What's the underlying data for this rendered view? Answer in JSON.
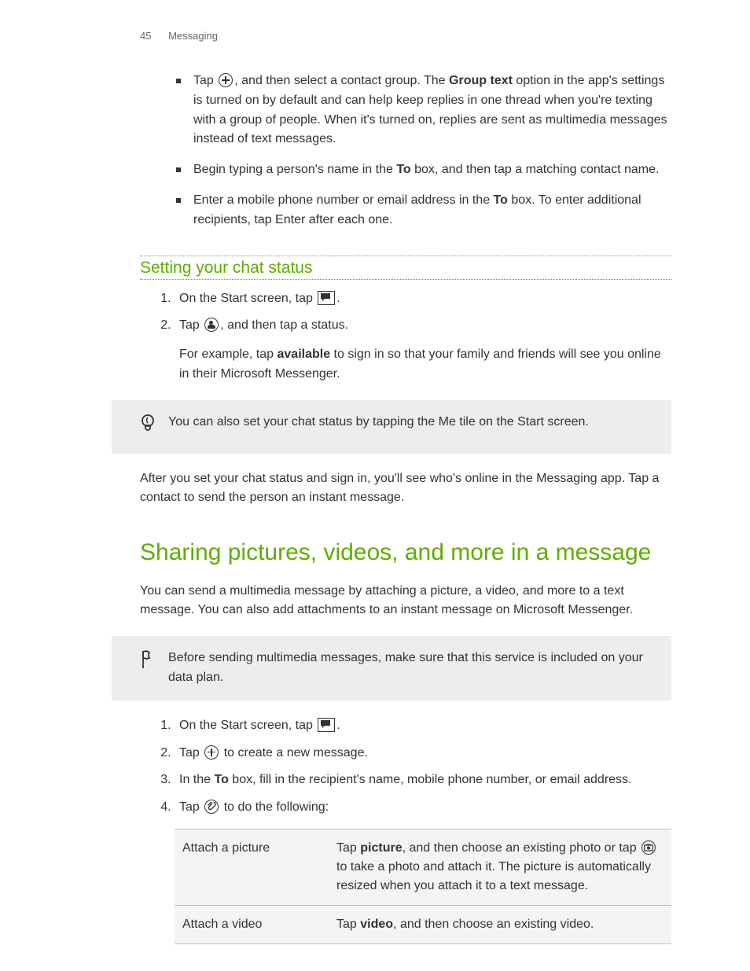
{
  "header": {
    "page_number": "45",
    "section": "Messaging"
  },
  "bullets": [
    {
      "pre": "Tap ",
      "icon": "plus",
      "post": ", and then select a contact group. The ",
      "bold": "Group text",
      "tail": " option in the app's settings is turned on by default and can help keep replies in one thread when you're texting with a group of people. When it's turned on, replies are sent as multimedia messages instead of text messages."
    },
    {
      "pre": "Begin typing a person's name in the ",
      "bold": "To",
      "post": " box, and then tap a matching contact name."
    },
    {
      "pre": "Enter a mobile phone number or email address in the ",
      "bold": "To",
      "post": " box. To enter additional recipients, tap Enter after each one."
    }
  ],
  "subheading1": "Setting your chat status",
  "steps1": {
    "s1_pre": "On the Start screen, tap ",
    "s1_post": ".",
    "s2_pre": "Tap ",
    "s2_post": ", and then tap a status.",
    "s2_sub_pre": "For example, tap ",
    "s2_sub_bold": "available",
    "s2_sub_post": " to sign in so that your family and friends will see you online in their Microsoft Messenger."
  },
  "tip": "You can also set your chat status by tapping the Me tile on the Start screen.",
  "after_tip": "After you set your chat status and sign in, you'll see who's online in the Messaging app. Tap a contact to send the person an instant message.",
  "section_title": "Sharing pictures, videos, and more in a message",
  "intro2": "You can send a multimedia message by attaching a picture, a video, and more to a text message. You can also add attachments to an instant message on Microsoft Messenger.",
  "note": "Before sending multimedia messages, make sure that this service is included on your data plan.",
  "steps2": {
    "s1_pre": "On the Start screen, tap ",
    "s1_post": ".",
    "s2_pre": "Tap ",
    "s2_post": " to create a new message.",
    "s3_pre": "In the ",
    "s3_bold": "To",
    "s3_post": " box, fill in the recipient's name, mobile phone number, or email address.",
    "s4_pre": "Tap ",
    "s4_post": " to do the following:"
  },
  "table": {
    "r1_label": "Attach a picture",
    "r1_pre": "Tap ",
    "r1_bold": "picture",
    "r1_mid": ", and then choose an existing photo or tap ",
    "r1_post": " to take a photo and attach it. The picture is automatically resized when you attach it to a text message.",
    "r2_label": "Attach a video",
    "r2_pre": "Tap ",
    "r2_bold": "video",
    "r2_post": ", and then choose an existing video."
  }
}
